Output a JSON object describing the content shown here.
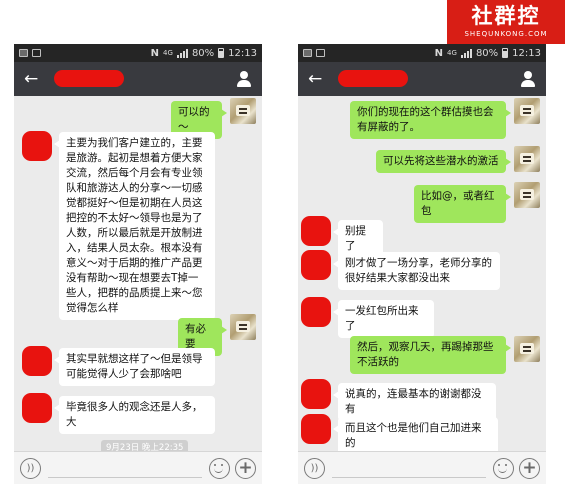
{
  "brand": {
    "name": "社群控",
    "url": "SHEQUNKONG.COM"
  },
  "status_bar": {
    "battery": "80%",
    "time": "12:13",
    "nfc": "N",
    "network": "4G"
  },
  "left_phone": {
    "messages": [
      {
        "side": "right",
        "text": "可以的～"
      },
      {
        "side": "left",
        "text": "主要为我们客户建立的，主要是旅游。起初是想着方便大家交流，然后每个月会有专业领队和旅游达人的分享～一切感觉都挺好～但是初期在人员这把控的不太好～领导也是为了人数，所以最后就是开放制进入，结果人员太杂。根本没有意义～对于后期的推广产品更没有帮助～现在想要去T掉一些人，把群的品质提上来～您觉得怎么样"
      },
      {
        "side": "right",
        "text": "有必要"
      },
      {
        "side": "left",
        "text": "其实早就想这样了～但是领导可能觉得人少了会那啥吧"
      },
      {
        "side": "left",
        "text": "毕竟很多人的观念还是人多，大"
      }
    ],
    "timestamp": "9月23日 晚上22:35"
  },
  "right_phone": {
    "messages": [
      {
        "side": "right",
        "text": "你们的现在的这个群估摸也会有屏蔽的了。"
      },
      {
        "side": "right",
        "text": "可以先将这些潜水的激活"
      },
      {
        "side": "right",
        "text": "比如@，或者红包"
      },
      {
        "side": "left",
        "text": "别提了"
      },
      {
        "side": "left",
        "text": "刚才做了一场分享，老师分享的很好结果大家都没出来"
      },
      {
        "side": "left",
        "text": "一发红包所出来了"
      },
      {
        "side": "right",
        "text": "然后，观察几天，再踢掉那些不活跃的"
      },
      {
        "side": "left",
        "text": "说真的，连最基本的谢谢都没有"
      },
      {
        "side": "left",
        "text": "而且这个也是他们自己加进来的"
      }
    ]
  },
  "icons": {
    "back": "back-arrow-icon",
    "contact": "person-icon",
    "voice": "voice-icon",
    "emoji": "smiley-icon",
    "more": "plus-icon"
  },
  "colors": {
    "green_bubble": "#9fe65c",
    "title_bar": "#393a3f",
    "brand": "#d81e15",
    "redaction": "#e8130f"
  }
}
